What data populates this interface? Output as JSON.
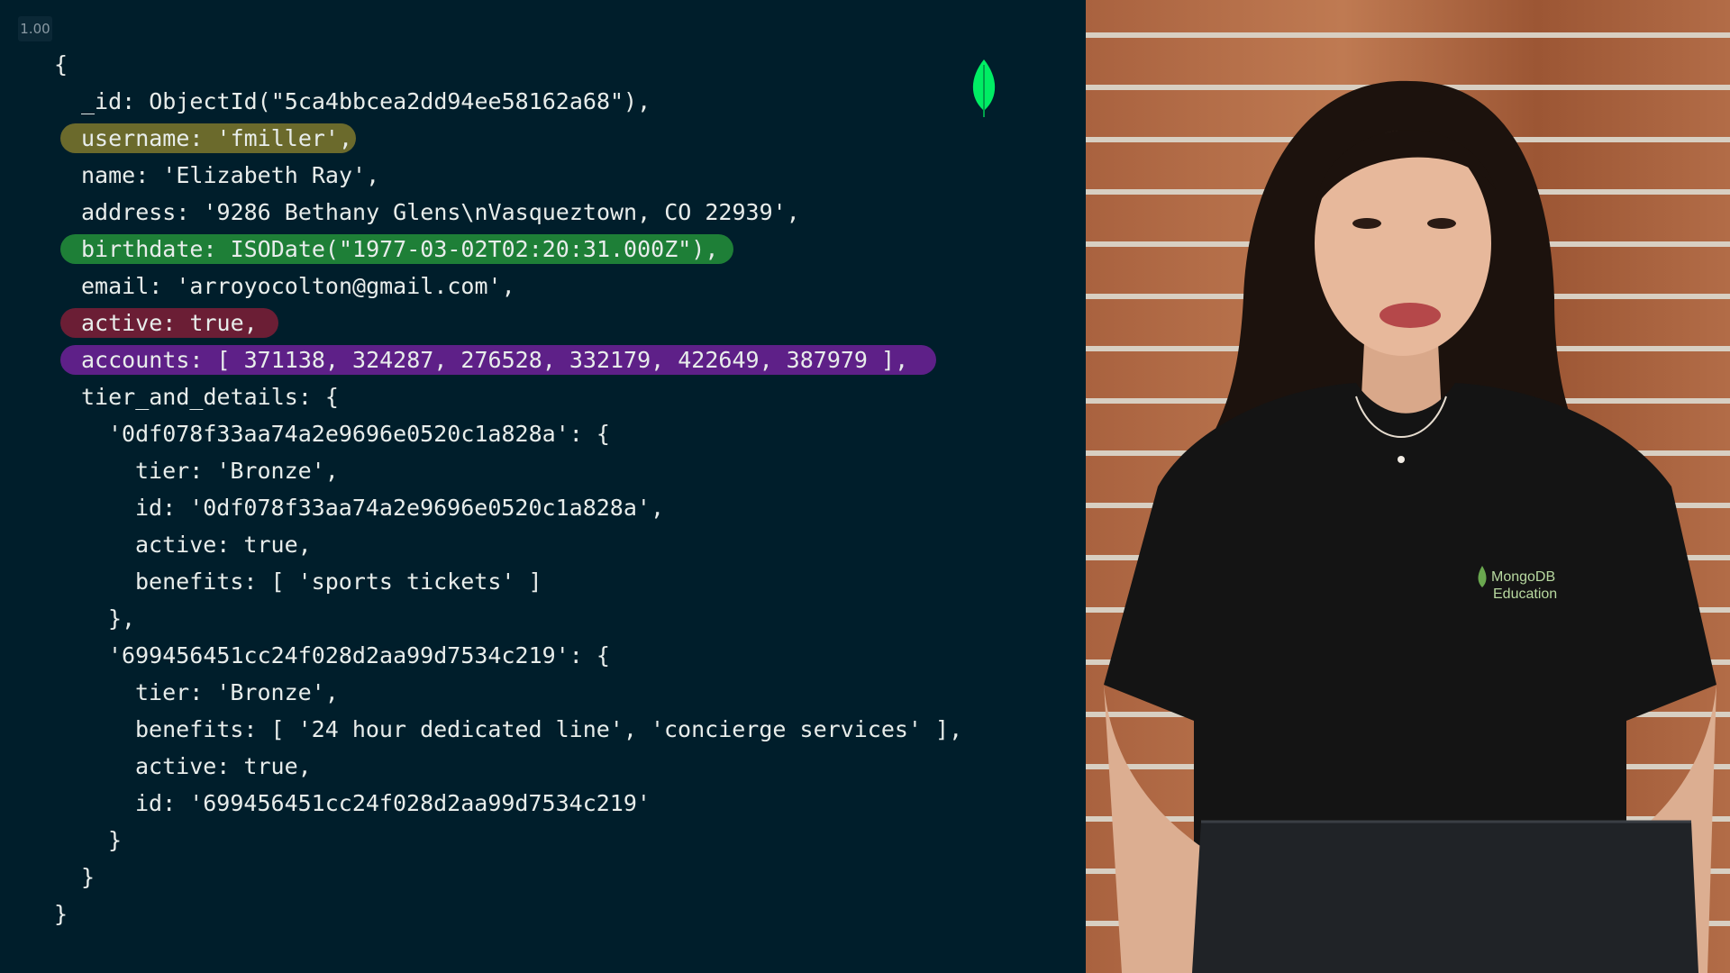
{
  "playback": {
    "speed": "1.00"
  },
  "code_lines": [
    {
      "text": "{",
      "indent": 0,
      "highlight": null,
      "highlight_width": 0
    },
    {
      "text": "_id: ObjectId(\"5ca4bbcea2dd94ee58162a68\"),",
      "indent": 1,
      "highlight": null,
      "highlight_width": 0
    },
    {
      "text": "username: 'fmiller',",
      "indent": 1,
      "highlight": "#6b6a2c",
      "highlight_width": 328
    },
    {
      "text": "name: 'Elizabeth Ray',",
      "indent": 1,
      "highlight": null,
      "highlight_width": 0
    },
    {
      "text": "address: '9286 Bethany Glens\\nVasqueztown, CO 22939',",
      "indent": 1,
      "highlight": null,
      "highlight_width": 0
    },
    {
      "text": "birthdate: ISODate(\"1977-03-02T02:20:31.000Z\"),",
      "indent": 1,
      "highlight": "#1e7f37",
      "highlight_width": 747
    },
    {
      "text": "email: 'arroyocolton@gmail.com',",
      "indent": 1,
      "highlight": null,
      "highlight_width": 0
    },
    {
      "text": "active: true,",
      "indent": 1,
      "highlight": "#6b1e35",
      "highlight_width": 242
    },
    {
      "text": "accounts: [ 371138, 324287, 276528, 332179, 422649, 387979 ],",
      "indent": 1,
      "highlight": "#5e2088",
      "highlight_width": 972
    },
    {
      "text": "tier_and_details: {",
      "indent": 1,
      "highlight": null,
      "highlight_width": 0
    },
    {
      "text": "'0df078f33aa74a2e9696e0520c1a828a': {",
      "indent": 2,
      "highlight": null,
      "highlight_width": 0
    },
    {
      "text": "tier: 'Bronze',",
      "indent": 3,
      "highlight": null,
      "highlight_width": 0
    },
    {
      "text": "id: '0df078f33aa74a2e9696e0520c1a828a',",
      "indent": 3,
      "highlight": null,
      "highlight_width": 0
    },
    {
      "text": "active: true,",
      "indent": 3,
      "highlight": null,
      "highlight_width": 0
    },
    {
      "text": "benefits: [ 'sports tickets' ]",
      "indent": 3,
      "highlight": null,
      "highlight_width": 0
    },
    {
      "text": "},",
      "indent": 2,
      "highlight": null,
      "highlight_width": 0
    },
    {
      "text": "'699456451cc24f028d2aa99d7534c219': {",
      "indent": 2,
      "highlight": null,
      "highlight_width": 0
    },
    {
      "text": "tier: 'Bronze',",
      "indent": 3,
      "highlight": null,
      "highlight_width": 0
    },
    {
      "text": "benefits: [ '24 hour dedicated line', 'concierge services' ],",
      "indent": 3,
      "highlight": null,
      "highlight_width": 0
    },
    {
      "text": "active: true,",
      "indent": 3,
      "highlight": null,
      "highlight_width": 0
    },
    {
      "text": "id: '699456451cc24f028d2aa99d7534c219'",
      "indent": 3,
      "highlight": null,
      "highlight_width": 0
    },
    {
      "text": "}",
      "indent": 2,
      "highlight": null,
      "highlight_width": 0
    },
    {
      "text": "}",
      "indent": 1,
      "highlight": null,
      "highlight_width": 0
    },
    {
      "text": "}",
      "indent": 0,
      "highlight": null,
      "highlight_width": 0
    }
  ],
  "colors": {
    "background": "#001e2b",
    "code_text": "#e8edeb",
    "leaf": "#00ed64"
  },
  "icons": {
    "logo": "mongodb-leaf-icon"
  },
  "video": {
    "shirt_logo_line1": "MongoDB",
    "shirt_logo_line2": "Education"
  }
}
